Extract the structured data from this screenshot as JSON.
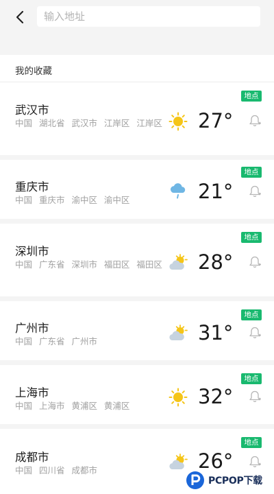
{
  "search": {
    "placeholder": "输入地址",
    "value": ""
  },
  "section_title": "我的收藏",
  "badge_label": "地点",
  "cities": [
    {
      "name": "武汉市",
      "address": "中国 湖北省 武汉市 江岸区 江岸区",
      "temp": "27°",
      "weather_icon": "sun-icon"
    },
    {
      "name": "重庆市",
      "address": "中国 重庆市 渝中区 渝中区",
      "temp": "21°",
      "weather_icon": "rain-cloud-icon"
    },
    {
      "name": "深圳市",
      "address": "中国 广东省 深圳市 福田区 福田区",
      "temp": "28°",
      "weather_icon": "partly-cloudy-icon"
    },
    {
      "name": "广州市",
      "address": "中国 广东省 广州市",
      "temp": "31°",
      "weather_icon": "partly-cloudy-icon"
    },
    {
      "name": "上海市",
      "address": "中国 上海市 黄浦区 黄浦区",
      "temp": "32°",
      "weather_icon": "sun-icon"
    },
    {
      "name": "成都市",
      "address": "中国 四川省 成都市",
      "temp": "26°",
      "weather_icon": "partly-cloudy-icon"
    }
  ],
  "watermark": "PCPOP下载",
  "colors": {
    "badge": "#19b96f",
    "sun": "#f5c518",
    "cloud": "#c6d3df",
    "rain_cloud": "#6fb6e4"
  }
}
